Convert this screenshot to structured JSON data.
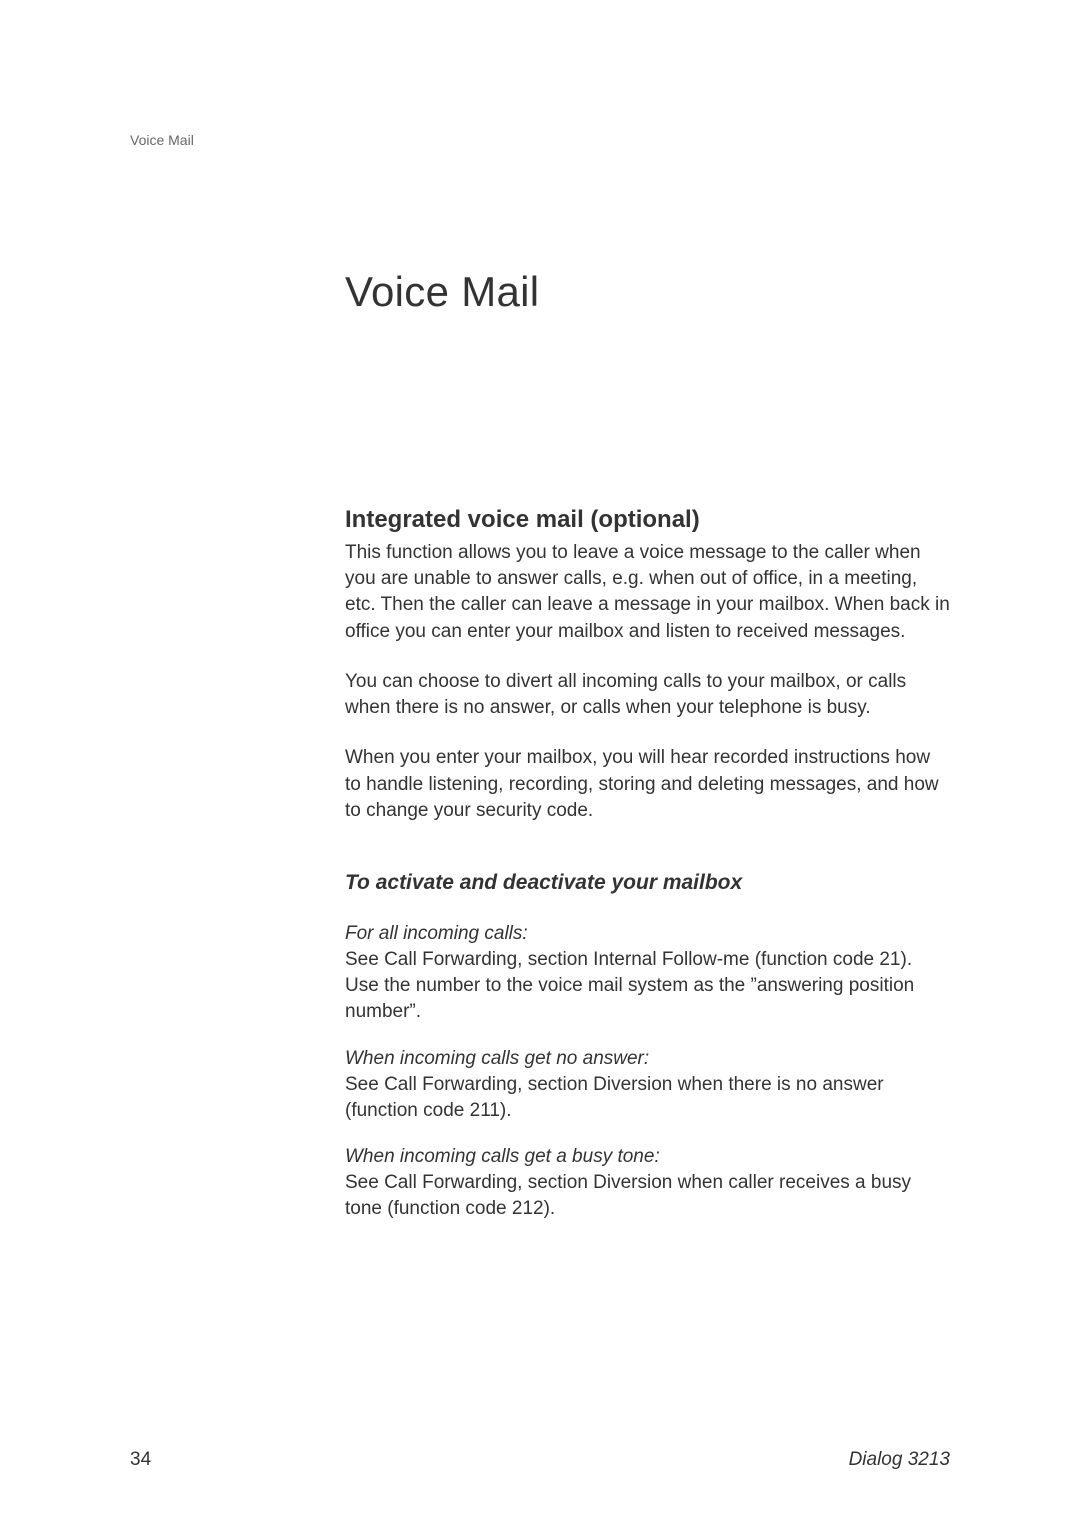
{
  "header": {
    "label": "Voice Mail"
  },
  "main": {
    "title": "Voice Mail",
    "section_heading": "Integrated voice mail (optional)",
    "paragraph1": "This function allows you to leave a voice message to the caller when you are unable to answer calls, e.g. when out of office, in a meeting, etc. Then the caller can leave a message in your mailbox. When back in office you can enter your mailbox and listen to received messages.",
    "paragraph2": "You can choose to divert all incoming calls to your mailbox, or calls when there is no answer, or calls when your telephone is busy.",
    "paragraph3": "When you enter your mailbox, you will hear recorded instructions how to handle listening, recording, storing and deleting messages, and how to change your security code.",
    "subsection_heading": "To activate and deactivate your mailbox",
    "items": [
      {
        "heading": "For all incoming calls:",
        "text": "See Call Forwarding, section Internal Follow-me (function code 21). Use the number to the voice mail system as the ”answering position number”."
      },
      {
        "heading": "When incoming calls get no answer:",
        "text": "See Call Forwarding, section Diversion when there is no answer (function code 211)."
      },
      {
        "heading": "When incoming calls get a busy tone:",
        "text": "See Call Forwarding, section Diversion when caller receives a busy tone (function code 212)."
      }
    ]
  },
  "footer": {
    "page_number": "34",
    "right_label": "Dialog 3213"
  }
}
